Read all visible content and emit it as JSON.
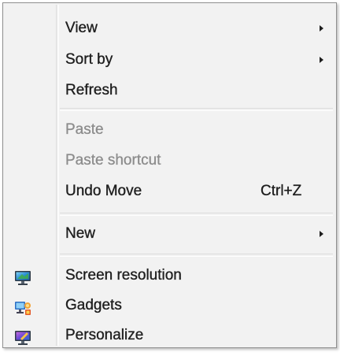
{
  "context_menu": {
    "view_label": "View",
    "sort_by_label": "Sort by",
    "refresh_label": "Refresh",
    "paste_label": "Paste",
    "paste_shortcut_label": "Paste shortcut",
    "undo_move_label": "Undo Move",
    "undo_move_shortcut": "Ctrl+Z",
    "new_label": "New",
    "screen_resolution_label": "Screen resolution",
    "gadgets_label": "Gadgets",
    "personalize_label": "Personalize",
    "icons": {
      "screen_resolution": "monitor-icon",
      "gadgets": "gadgets-icon",
      "personalize": "personalize-icon"
    },
    "colors": {
      "menu_background": "#f2f2f2",
      "text": "#1e1e1e",
      "disabled_text": "#8c8c8c"
    }
  }
}
